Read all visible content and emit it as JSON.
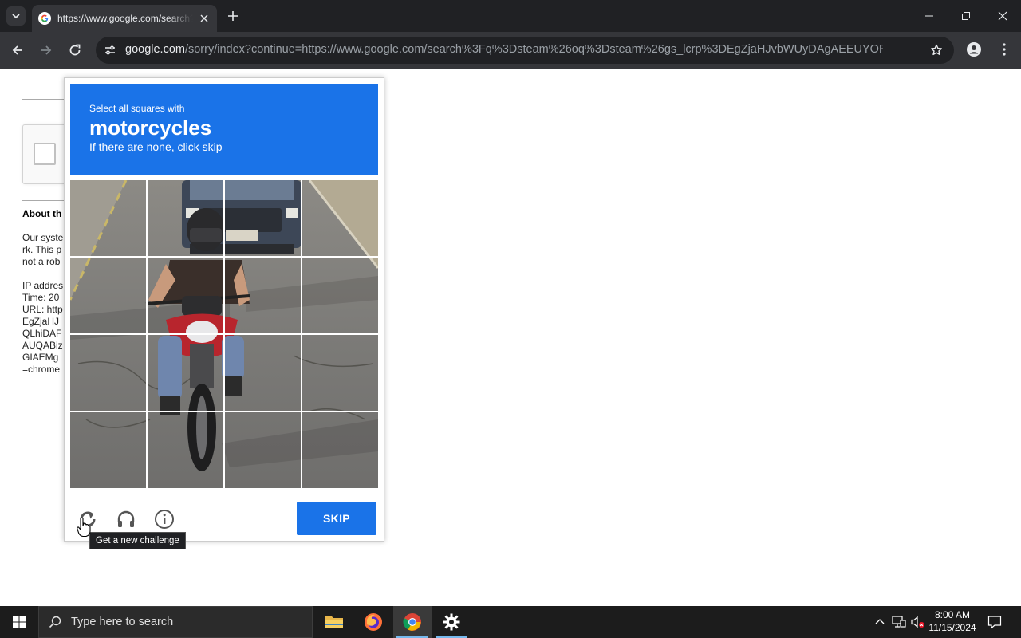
{
  "browser": {
    "tab_title": "https://www.google.com/search?q=steam",
    "url_host": "google.com",
    "url_rest": "/sorry/index?continue=https://www.google.com/search%3Fq%3Dsteam%26oq%3Dsteam%26gs_lcrp%3DEgZjaHJvbWUyDAgAEEUYORixAxiABDIKC..."
  },
  "page": {
    "about_heading": "About th",
    "lines_1": [
      "Our syste",
      "rk. This p",
      "not a rob"
    ],
    "lines_2": [
      "IP addres",
      "Time: 20",
      "URL: http",
      "EgZjaHJ",
      "QLhiDAF",
      "AUQABiz",
      "GIAEMg",
      "=chrome"
    ]
  },
  "challenge": {
    "instruction_small": "Select all squares with",
    "target_word": "motorcycles",
    "hint": "If there are none, click skip",
    "skip_label": "SKIP",
    "tooltip": "Get a new challenge",
    "grid_rows": 4,
    "grid_cols": 4,
    "accent_color": "#1a73e8"
  },
  "taskbar": {
    "search_placeholder": "Type here to search",
    "time": "8:00 AM",
    "date": "11/15/2024"
  }
}
